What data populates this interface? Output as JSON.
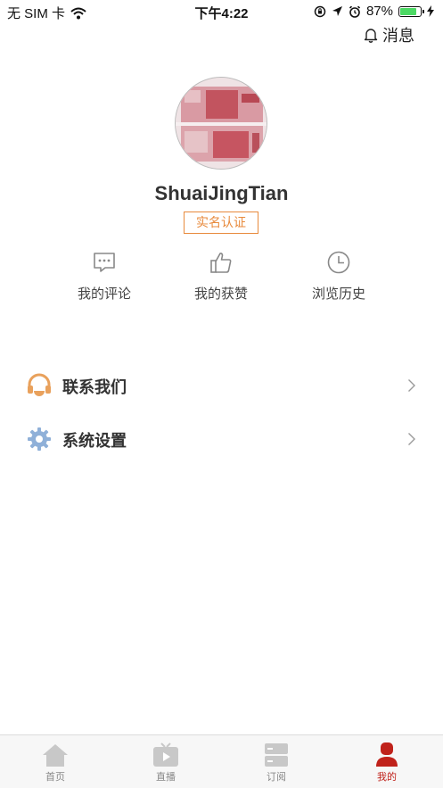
{
  "status_bar": {
    "carrier": "无 SIM 卡",
    "time": "下午4:22",
    "battery_percent": "87%",
    "battery_level": 0.87,
    "battery_color": "#4cd964"
  },
  "header": {
    "messages_label": "消息",
    "messages_icon": "bell-icon"
  },
  "profile": {
    "username": "ShuaiJingTian",
    "verify_label": "实名认证",
    "verify_color": "#e88a3c"
  },
  "quick_actions": [
    {
      "label": "我的评论",
      "icon": "comment-icon"
    },
    {
      "label": "我的获赞",
      "icon": "thumbs-up-icon"
    },
    {
      "label": "浏览历史",
      "icon": "clock-icon"
    }
  ],
  "menu": [
    {
      "label": "联系我们",
      "icon": "headset-icon",
      "icon_color": "#e9a15c"
    },
    {
      "label": "系统设置",
      "icon": "gear-icon",
      "icon_color": "#8fb0d8"
    }
  ],
  "tabbar": {
    "active_color": "#c0221b",
    "tabs": [
      {
        "label": "首页",
        "icon": "home-icon"
      },
      {
        "label": "直播",
        "icon": "tv-play-icon"
      },
      {
        "label": "订阅",
        "icon": "subscription-icon"
      },
      {
        "label": "我的",
        "icon": "person-icon",
        "active": true
      }
    ]
  }
}
